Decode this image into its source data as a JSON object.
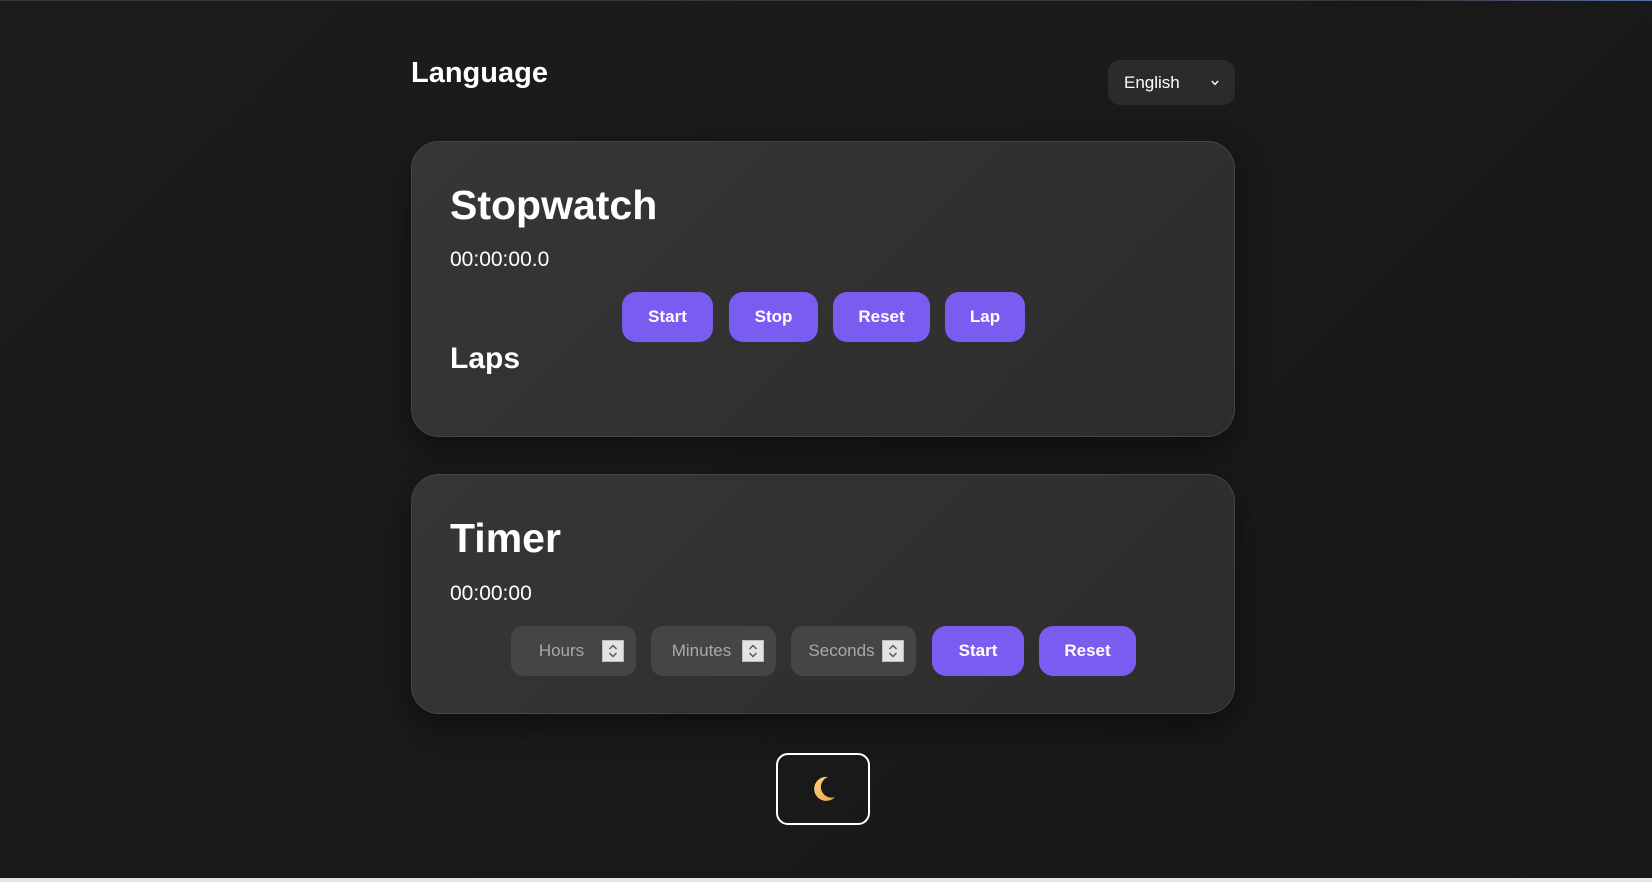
{
  "language": {
    "title": "Language",
    "selected": "English"
  },
  "stopwatch": {
    "title": "Stopwatch",
    "display": "00:00:00.0",
    "buttons": {
      "start": "Start",
      "stop": "Stop",
      "reset": "Reset",
      "lap": "Lap"
    },
    "laps_title": "Laps"
  },
  "timer": {
    "title": "Timer",
    "display": "00:00:00",
    "inputs": {
      "hours_placeholder": "Hours",
      "minutes_placeholder": "Minutes",
      "seconds_placeholder": "Seconds"
    },
    "buttons": {
      "start": "Start",
      "reset": "Reset"
    }
  },
  "theme_toggle": {
    "icon": "moon-icon"
  },
  "colors": {
    "accent": "#7b5cf0",
    "background": "#1a1a1a",
    "card": "#303030",
    "input": "#454545"
  }
}
